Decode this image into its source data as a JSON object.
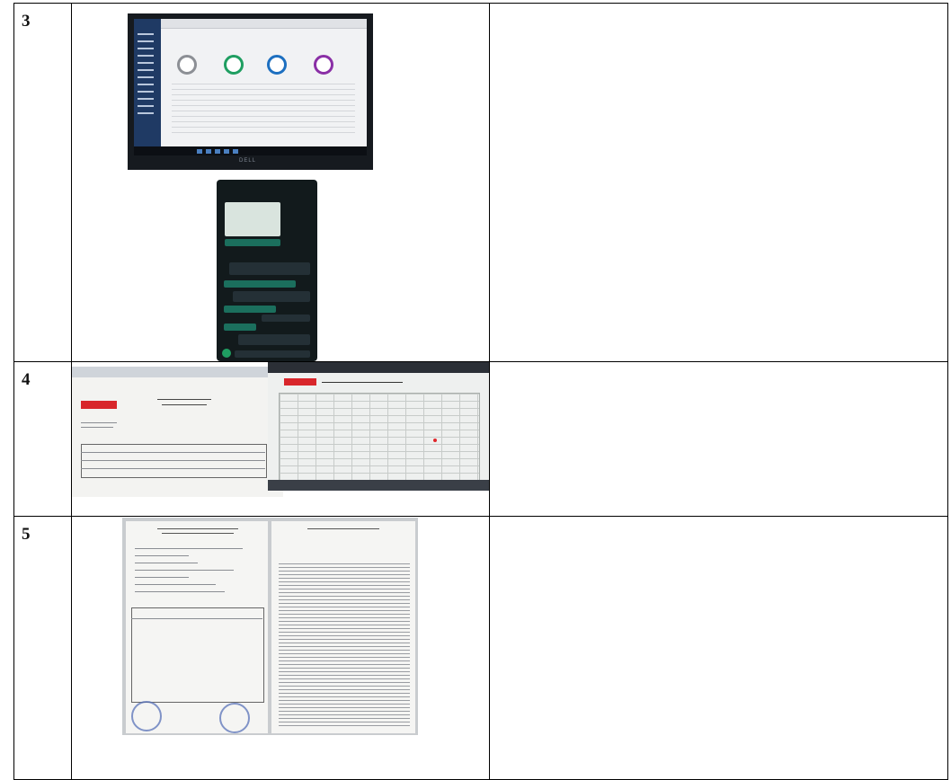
{
  "rows": [
    {
      "number": "3"
    },
    {
      "number": "4"
    },
    {
      "number": "5"
    }
  ],
  "photos": {
    "row3_laptop": {
      "brand": "DELL"
    }
  },
  "colors": {
    "border": "#000000",
    "brand_red": "#d8262b",
    "sidebar_blue": "#1f3a64",
    "chat_green": "#1b6f5d",
    "stamp_blue": "#5872b8"
  }
}
